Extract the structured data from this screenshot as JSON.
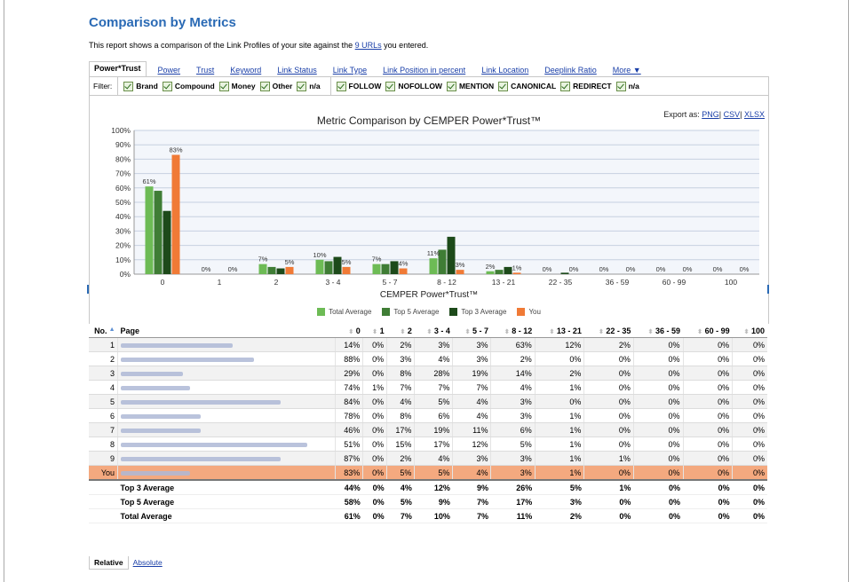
{
  "title": "Comparison by Metrics",
  "intro": {
    "before": "This report shows a comparison of the Link Profiles of your site against the ",
    "link": "9 URLs",
    "after": " you entered."
  },
  "tabs": [
    "Power*Trust",
    "Power",
    "Trust",
    "Keyword",
    "Link Status",
    "Link Type",
    "Link Position in percent",
    "Link Location",
    "Deeplink Ratio",
    "More ▼"
  ],
  "active_tab": "Power*Trust",
  "filter": {
    "label": "Filter:",
    "groups": [
      [
        "Brand",
        "Compound",
        "Money",
        "Other",
        "n/a"
      ],
      [
        "FOLLOW",
        "NOFOLLOW",
        "MENTION",
        "CANONICAL",
        "REDIRECT",
        "n/a"
      ]
    ]
  },
  "export": {
    "label": "Export as:",
    "png": "PNG",
    "csv": "CSV",
    "xlsx": "XLSX",
    "sep": "|"
  },
  "chart_data": {
    "type": "bar",
    "title": "Metric Comparison by CEMPER Power*Trust™",
    "xlabel": "CEMPER Power*Trust™",
    "ylabel": "",
    "ylim": [
      0,
      100
    ],
    "yticks": [
      "0%",
      "10%",
      "20%",
      "30%",
      "40%",
      "50%",
      "60%",
      "70%",
      "80%",
      "90%",
      "100%"
    ],
    "categories": [
      "0",
      "1",
      "2",
      "3 - 4",
      "5 - 7",
      "8 - 12",
      "13 - 21",
      "22 - 35",
      "36 - 59",
      "60 - 99",
      "100"
    ],
    "series": [
      {
        "name": "Total Average",
        "color": "#6dbb55",
        "values": [
          61,
          0,
          7,
          10,
          7,
          11,
          2,
          0,
          0,
          0,
          0
        ]
      },
      {
        "name": "Top 5 Average",
        "color": "#3f7d35",
        "values": [
          58,
          0,
          5,
          9,
          7,
          17,
          3,
          0,
          0,
          0,
          0
        ]
      },
      {
        "name": "Top 3 Average",
        "color": "#1d4a1a",
        "values": [
          44,
          0,
          4,
          12,
          9,
          26,
          5,
          1,
          0,
          0,
          0
        ]
      },
      {
        "name": "You",
        "color": "#f07a36",
        "values": [
          83,
          0,
          5,
          5,
          4,
          3,
          1,
          0,
          0,
          0,
          0
        ]
      }
    ],
    "data_labels": [
      "61%",
      "83%",
      "0%",
      "0%",
      "7%",
      "5%",
      "10%",
      "5%",
      "7%",
      "4%",
      "11%",
      "3%",
      "2%",
      "1%",
      "0%",
      "0%",
      "0%",
      "0%",
      "0%",
      "0%",
      "0%",
      "0%"
    ],
    "grid": true,
    "legend": "bottom"
  },
  "table": {
    "headers": [
      "No.",
      "Page",
      "0",
      "1",
      "2",
      "3 - 4",
      "5 - 7",
      "8 - 12",
      "13 - 21",
      "22 - 35",
      "36 - 59",
      "60 - 99",
      "100"
    ],
    "rows": [
      {
        "no": "1",
        "values": [
          "14%",
          "0%",
          "2%",
          "3%",
          "3%",
          "63%",
          "12%",
          "2%",
          "0%",
          "0%",
          "0%"
        ]
      },
      {
        "no": "2",
        "values": [
          "88%",
          "0%",
          "3%",
          "4%",
          "3%",
          "2%",
          "0%",
          "0%",
          "0%",
          "0%",
          "0%"
        ]
      },
      {
        "no": "3",
        "values": [
          "29%",
          "0%",
          "8%",
          "28%",
          "19%",
          "14%",
          "2%",
          "0%",
          "0%",
          "0%",
          "0%"
        ]
      },
      {
        "no": "4",
        "values": [
          "74%",
          "1%",
          "7%",
          "7%",
          "7%",
          "4%",
          "1%",
          "0%",
          "0%",
          "0%",
          "0%"
        ]
      },
      {
        "no": "5",
        "values": [
          "84%",
          "0%",
          "4%",
          "5%",
          "4%",
          "3%",
          "0%",
          "0%",
          "0%",
          "0%",
          "0%"
        ]
      },
      {
        "no": "6",
        "values": [
          "78%",
          "0%",
          "8%",
          "6%",
          "4%",
          "3%",
          "1%",
          "0%",
          "0%",
          "0%",
          "0%"
        ]
      },
      {
        "no": "7",
        "values": [
          "46%",
          "0%",
          "17%",
          "19%",
          "11%",
          "6%",
          "1%",
          "0%",
          "0%",
          "0%",
          "0%"
        ]
      },
      {
        "no": "8",
        "values": [
          "51%",
          "0%",
          "15%",
          "17%",
          "12%",
          "5%",
          "1%",
          "0%",
          "0%",
          "0%",
          "0%"
        ]
      },
      {
        "no": "9",
        "values": [
          "87%",
          "0%",
          "2%",
          "4%",
          "3%",
          "3%",
          "1%",
          "1%",
          "0%",
          "0%",
          "0%"
        ]
      },
      {
        "no": "You",
        "values": [
          "83%",
          "0%",
          "5%",
          "5%",
          "4%",
          "3%",
          "1%",
          "0%",
          "0%",
          "0%",
          "0%"
        ]
      }
    ],
    "averages": [
      {
        "label": "Top 3 Average",
        "values": [
          "44%",
          "0%",
          "4%",
          "12%",
          "9%",
          "26%",
          "5%",
          "1%",
          "0%",
          "0%",
          "0%"
        ]
      },
      {
        "label": "Top 5 Average",
        "values": [
          "58%",
          "0%",
          "5%",
          "9%",
          "7%",
          "17%",
          "3%",
          "0%",
          "0%",
          "0%",
          "0%"
        ]
      },
      {
        "label": "Total Average",
        "values": [
          "61%",
          "0%",
          "7%",
          "10%",
          "7%",
          "11%",
          "2%",
          "0%",
          "0%",
          "0%",
          "0%"
        ]
      }
    ]
  },
  "bottom_tabs": [
    "Relative",
    "Absolute"
  ],
  "active_bottom_tab": "Relative"
}
